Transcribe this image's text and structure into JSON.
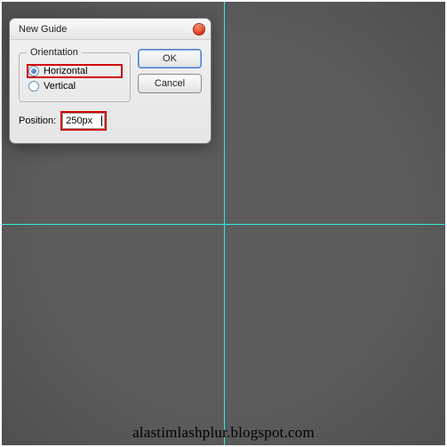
{
  "dialog": {
    "title": "New Guide",
    "orientation": {
      "legend": "Orientation",
      "horizontal_label": "Horizontal",
      "vertical_label": "Vertical",
      "selected": "horizontal"
    },
    "position": {
      "label": "Position:",
      "value": "250px"
    },
    "buttons": {
      "ok": "OK",
      "cancel": "Cancel"
    }
  },
  "colors": {
    "guide": "#2aeee0",
    "highlight": "#d10000",
    "canvas": "#5d5d5d"
  },
  "watermark": "alastimlashplur.blogspot.com"
}
